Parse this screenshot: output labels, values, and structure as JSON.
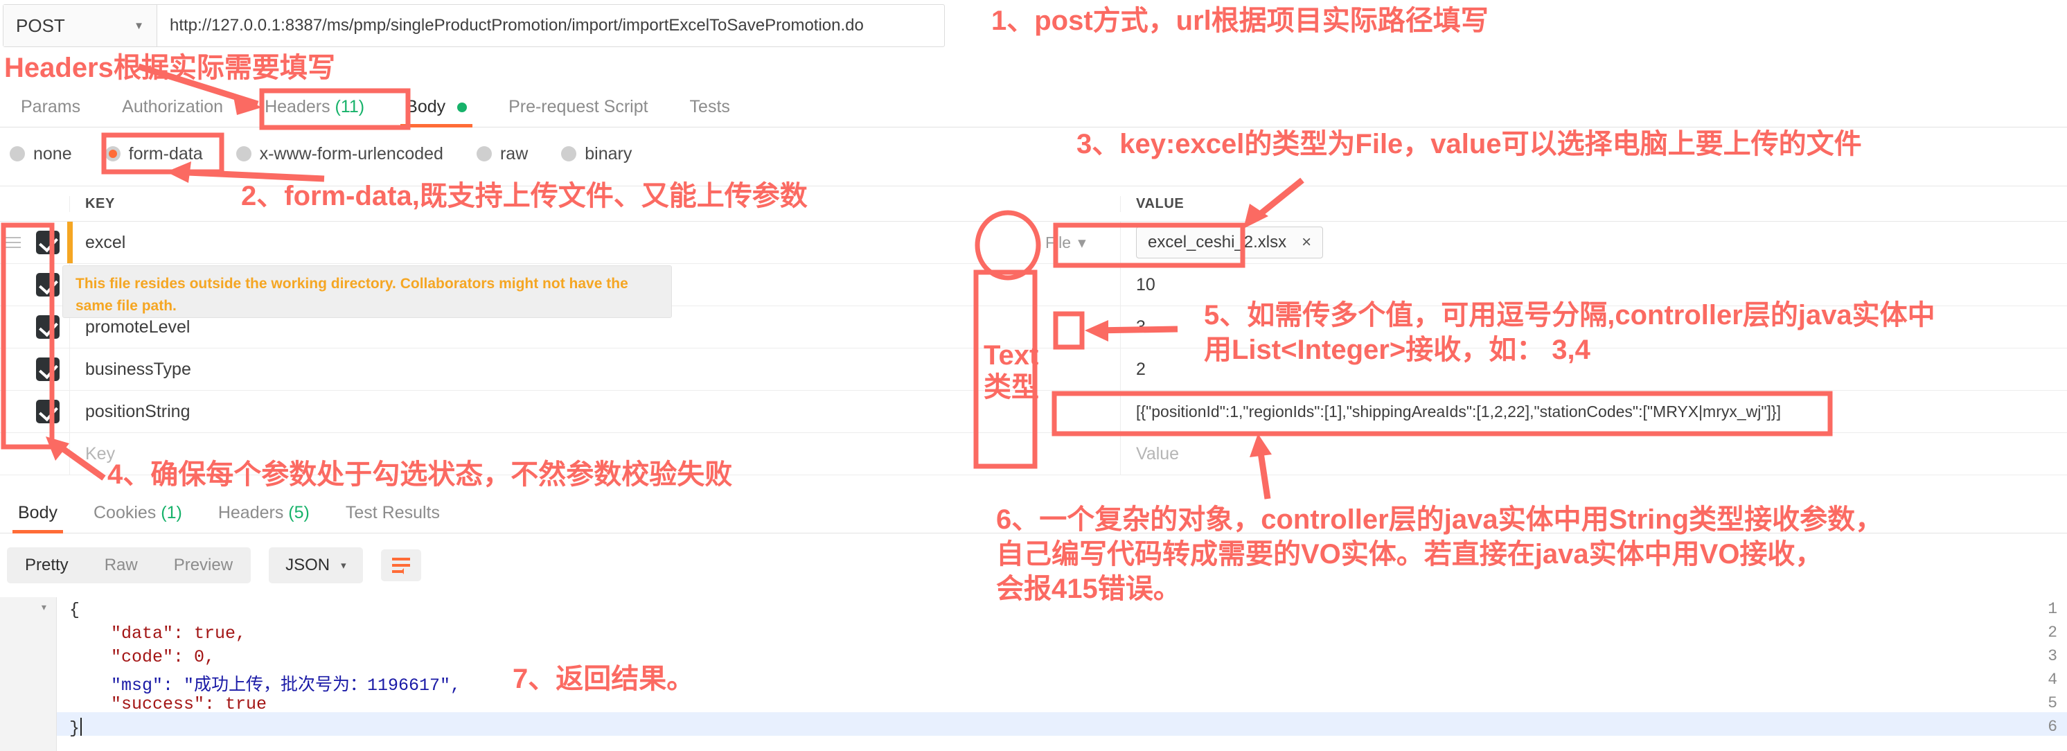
{
  "request": {
    "method": "POST",
    "url": "http://127.0.0.1:8387/ms/pmp/singleProductPromotion/import/importExcelToSavePromotion.do",
    "tabs": [
      {
        "label": "Params",
        "active": false
      },
      {
        "label": "Authorization",
        "active": false
      },
      {
        "label": "Headers",
        "count": "(11)",
        "active": false
      },
      {
        "label": "Body",
        "active": true,
        "dot": true
      },
      {
        "label": "Pre-request Script",
        "active": false
      },
      {
        "label": "Tests",
        "active": false
      }
    ],
    "body_types": [
      {
        "label": "none",
        "selected": false
      },
      {
        "label": "form-data",
        "selected": true
      },
      {
        "label": "x-www-form-urlencoded",
        "selected": false
      },
      {
        "label": "raw",
        "selected": false
      },
      {
        "label": "binary",
        "selected": false
      }
    ],
    "table": {
      "headers": {
        "key": "KEY",
        "value": "VALUE"
      },
      "rows": [
        {
          "checked": true,
          "key": "excel",
          "type": "File",
          "value": "excel_ceshi_2.xlsx",
          "is_file": true,
          "warn_bar": true
        },
        {
          "checked": true,
          "key": "",
          "type": "",
          "value": "10"
        },
        {
          "checked": true,
          "key": "promoteLevel",
          "type": "",
          "value": "3"
        },
        {
          "checked": true,
          "key": "businessType",
          "type": "",
          "value": "2"
        },
        {
          "checked": true,
          "key": "positionString",
          "type": "",
          "value": "[{\"positionId\":1,\"regionIds\":[1],\"shippingAreaIds\":[1,2,22],\"stationCodes\":[\"MRYX|mryx_wj\"]}]"
        },
        {
          "checked": false,
          "key": "",
          "key_placeholder": "Key",
          "type": "",
          "value": "",
          "value_placeholder": "Value"
        }
      ],
      "file_chip_remove": "×",
      "type_caret": "▾"
    },
    "warning": "This file resides outside the working directory. Collaborators might not have the same file path."
  },
  "response": {
    "tabs": [
      {
        "label": "Body",
        "active": true
      },
      {
        "label": "Cookies",
        "count": "(1)",
        "active": false
      },
      {
        "label": "Headers",
        "count": "(5)",
        "active": false
      },
      {
        "label": "Test Results",
        "active": false
      }
    ],
    "view_modes": [
      {
        "label": "Pretty",
        "active": true
      },
      {
        "label": "Raw",
        "active": false
      },
      {
        "label": "Preview",
        "active": false
      }
    ],
    "format": "JSON",
    "format_caret": "▾",
    "code_lines": [
      {
        "num": "1",
        "fold": "▾",
        "text": "{"
      },
      {
        "num": "2",
        "fold": "",
        "text": "    \"data\": true,"
      },
      {
        "num": "3",
        "fold": "",
        "text": "    \"code\": 0,"
      },
      {
        "num": "4",
        "fold": "",
        "text": "    \"msg\": \"成功上传，批次号为：1196617\","
      },
      {
        "num": "5",
        "fold": "",
        "text": "    \"success\": true"
      },
      {
        "num": "6",
        "fold": "",
        "text": "}"
      }
    ]
  },
  "annotations": [
    {
      "id": "ann1",
      "text": "1、post方式，url根据项目实际路径填写"
    },
    {
      "id": "ann-headers",
      "text": "Headers根据实际需要填写"
    },
    {
      "id": "ann2",
      "text": "2、form-data,既支持上传文件、又能上传参数"
    },
    {
      "id": "ann3",
      "text": "3、key:excel的类型为File，value可以选择电脑上要上传的文件"
    },
    {
      "id": "ann4",
      "text": "4、确保每个参数处于勾选状态，不然参数校验失败"
    },
    {
      "id": "ann5",
      "text": "5、如需传多个值，可用逗号分隔,controller层的java实体中\n用List<Integer>接收，如： 3,4"
    },
    {
      "id": "ann6",
      "text": "6、一个复杂的对象，controller层的java实体中用String类型接收参数，\n自己编写代码转成需要的VO实体。若直接在java实体中用VO接收，\n会报415错误。"
    },
    {
      "id": "ann7",
      "text": "7、返回结果。"
    },
    {
      "id": "ann-text-type",
      "text": "Text\n类型"
    }
  ],
  "colors": {
    "accent": "#ff6c37",
    "annotation": "#fb6a62",
    "warning": "#f5a623",
    "count_green": "#17b26a"
  }
}
